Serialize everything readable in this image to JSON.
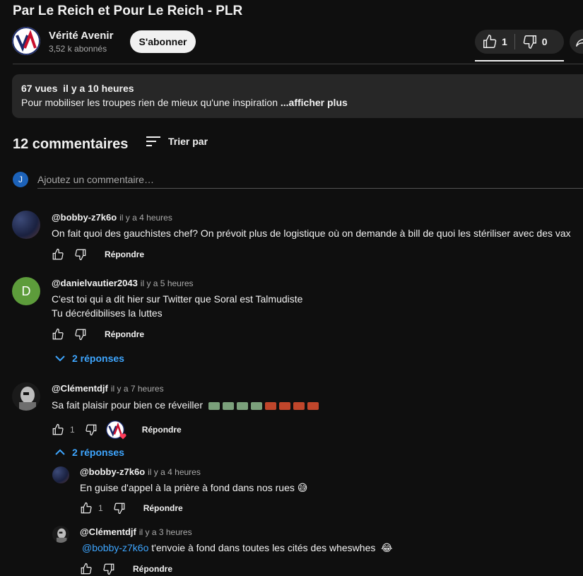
{
  "video": {
    "title": "Par Le Reich et Pour Le Reich - PLR",
    "channel_name": "Vérité Avenir",
    "subscribers": "3,52 k abonnés",
    "subscribe_label": "S'abonner",
    "likes": "1",
    "dislikes": "0"
  },
  "description": {
    "meta": "67 vues  il y a 10 heures",
    "text": "Pour mobiliser les troupes rien de mieux qu'une inspiration ",
    "more_label": "...afficher plus"
  },
  "comments_header": {
    "count": "12 commentaires",
    "sort_label": "Trier par",
    "avatar_letter": "J",
    "add_placeholder": "Ajoutez un commentaire…"
  },
  "reply_label": "Répondre",
  "comments": [
    {
      "author": "@bobby-z7k6o",
      "time": "il y a 4 heures",
      "text": "On fait quoi des gauchistes chef? On prévoit plus de logistique où on demande à bill de quoi les stériliser avec des vax"
    },
    {
      "author": "@danielvautier2043",
      "time": "il y a 5 heures",
      "avatar_letter": "D",
      "text_line1": "C'est toi qui a dit hier sur Twitter que Soral est Talmudiste",
      "text_line2": "Tu décrédibilises la luttes",
      "replies_label": "2 réponses"
    },
    {
      "author": "@Clémentdjf",
      "time": "il y a 7 heures",
      "text": "Sa fait plaisir pour bien ce réveiller",
      "likes": "1",
      "replies_label": "2 réponses"
    }
  ],
  "replies": [
    {
      "author": "@bobby-z7k6o",
      "time": "il y a 4 heures",
      "text": "En guise d'appel à la prière à fond dans nos rues 😅",
      "likes": "1"
    },
    {
      "author": "@Clémentdjf",
      "time": "il y a 3 heures",
      "mention": "@bobby-z7k6o",
      "text": " t'envoie à fond dans toutes les cités des wheswhes  😂"
    }
  ],
  "colors": {
    "background": "#0f0f0f",
    "link_blue": "#3ea6ff",
    "subscribe_bg": "#f1f1f1",
    "pill_bg": "#272727"
  }
}
